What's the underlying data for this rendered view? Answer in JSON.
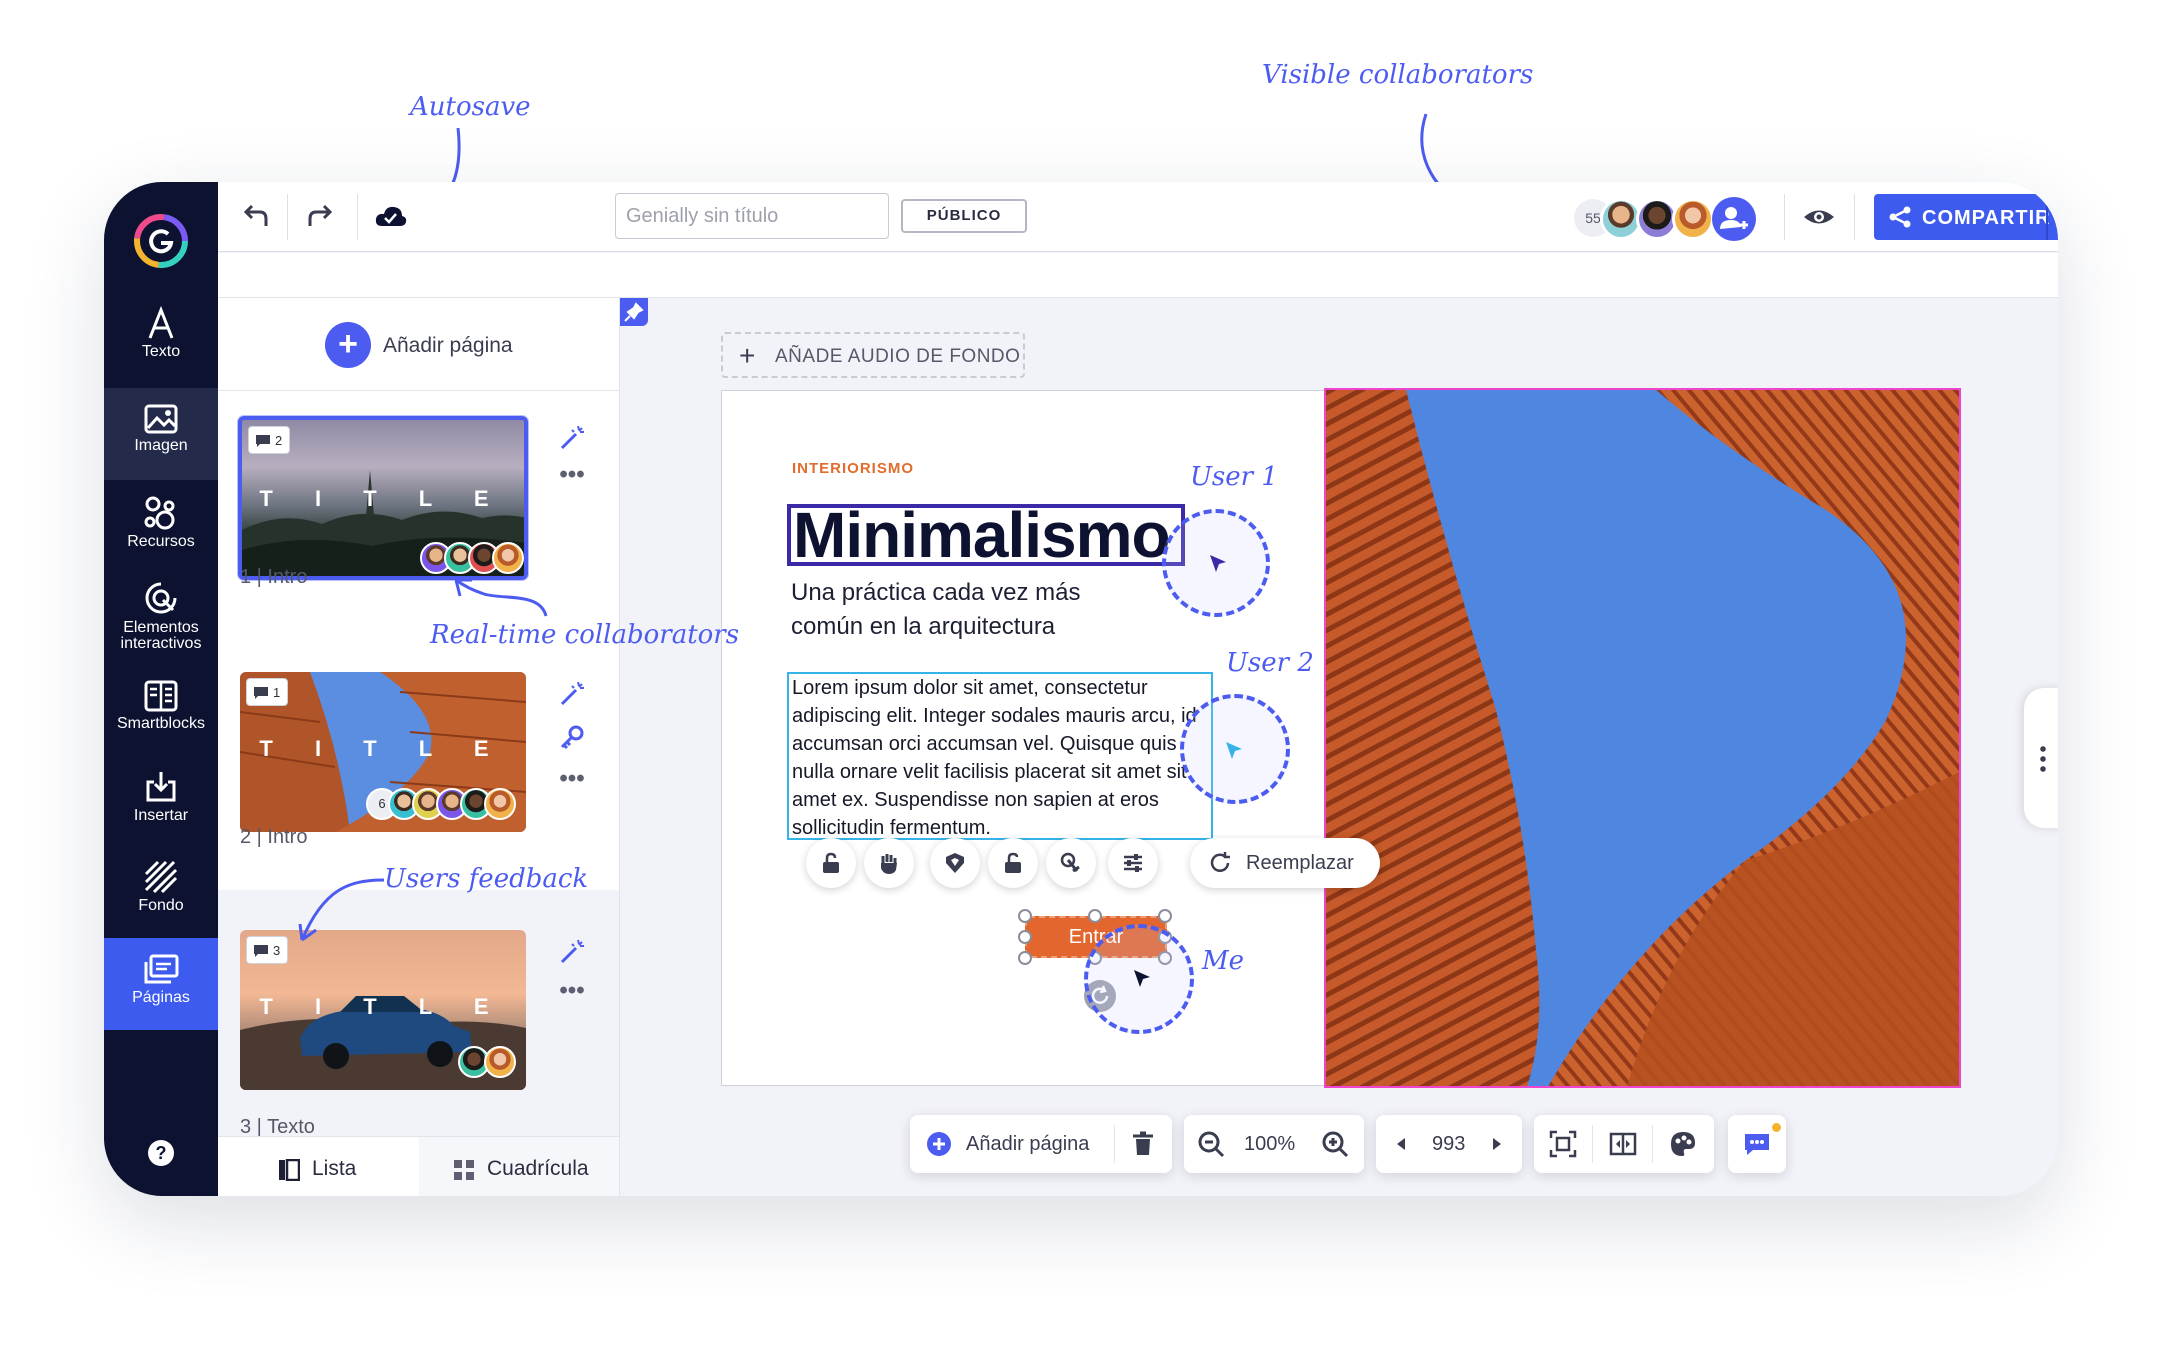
{
  "colors": {
    "rail": "#0c1230",
    "accent": "#3e5bf0",
    "orange": "#e2662d",
    "magenta": "#ee44d0",
    "lorem_border": "#36b3e8"
  },
  "annotations": {
    "autosave": "Autosave",
    "visible_collaborators": "Visible collaborators",
    "realtime_collaborators": "Real-time collaborators",
    "users_feedback": "Users feedback",
    "user1": "User 1",
    "user2": "User 2",
    "me": "Me"
  },
  "rail": {
    "items": [
      {
        "label": "Texto",
        "icon": "text-icon"
      },
      {
        "label": "Imagen",
        "icon": "image-icon"
      },
      {
        "label": "Recursos",
        "icon": "resources-icon"
      },
      {
        "label": "Elementos interactivos",
        "icon": "interactive-icon"
      },
      {
        "label": "Smartblocks",
        "icon": "smartblocks-icon"
      },
      {
        "label": "Insertar",
        "icon": "insert-icon"
      },
      {
        "label": "Fondo",
        "icon": "background-icon"
      },
      {
        "label": "Páginas",
        "icon": "pages-icon"
      }
    ],
    "help": "?"
  },
  "topbar": {
    "title_placeholder": "Genially sin título",
    "public_label": "PÚBLICO",
    "collaborator_count": "55",
    "share_label": "COMPARTIR"
  },
  "panel": {
    "add_page": "Añadir página",
    "pages": [
      {
        "label": "1 | Intro",
        "title": "T I T L E",
        "comments": "2"
      },
      {
        "label": "2 | Intro",
        "title": "T I T L E",
        "comments": "1",
        "extra_count": "6"
      },
      {
        "label": "3 | Texto",
        "title": "T I T L E",
        "comments": "3"
      }
    ],
    "view_tabs": {
      "list": "Lista",
      "grid": "Cuadrícula"
    }
  },
  "canvas": {
    "audio_button": "AÑADE AUDIO DE FONDO",
    "eyebrow": "INTERIORISMO",
    "heading": "Minimalismo",
    "subheading": "Una práctica cada vez más común en la arquitectura",
    "body": "Lorem ipsum dolor sit amet, consectetur adipiscing elit. Integer sodales mauris arcu, id accumsan orci accumsan vel. Quisque quis nulla ornare velit facilisis placerat sit amet sit amet ex. Suspendisse non sapien at eros sollicitudin fermentum.",
    "replace_label": "Reemplazar",
    "enter_button": "Entrar"
  },
  "bottom_toolbar": {
    "add_page": "Añadir página",
    "zoom": "100%",
    "page_number": "993"
  }
}
